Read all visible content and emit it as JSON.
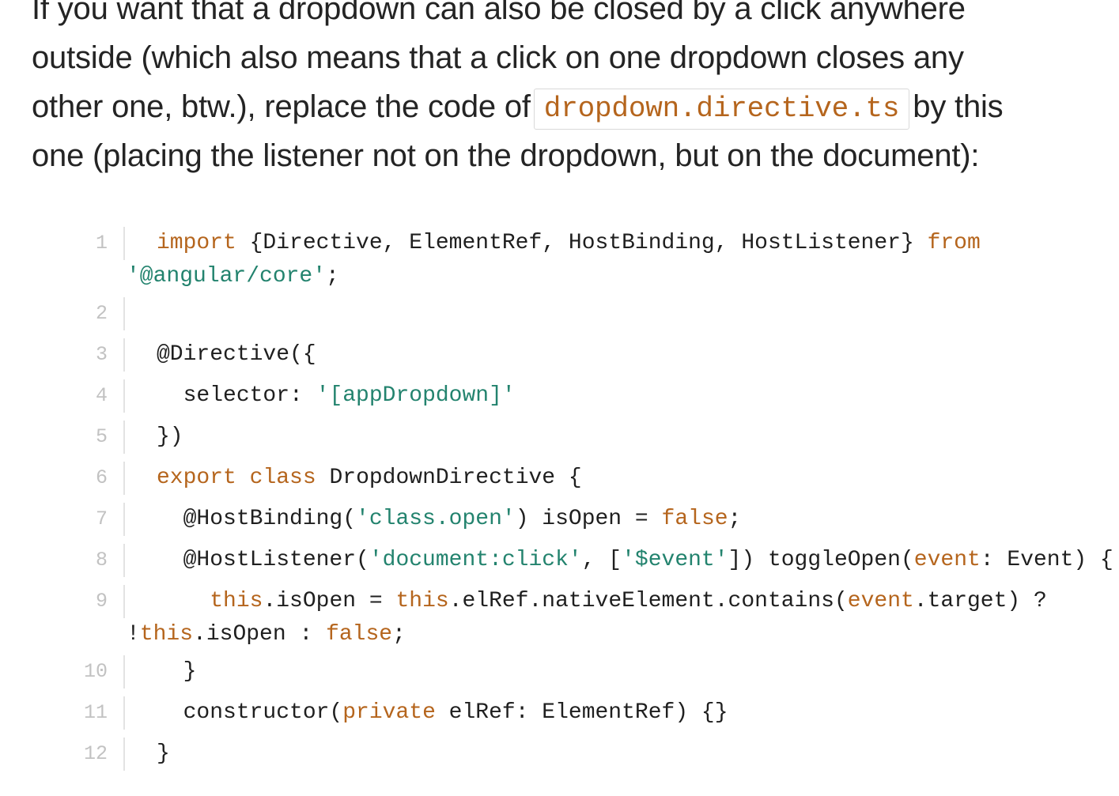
{
  "paragraph": {
    "line1": "If you want that a dropdown can also be closed by a click anywhere",
    "line2": "outside (which also means that a click on one dropdown closes any",
    "line3_before": "other one, btw.), replace the code of",
    "inline_code": "dropdown.directive.ts",
    "line3_after": "by this",
    "line4": "one (placing the listener not on the dropdown, but on the document):"
  },
  "code": {
    "line_numbers": [
      "1",
      "2",
      "3",
      "4",
      "5",
      "6",
      "7",
      "8",
      "9",
      "10",
      "11",
      "12"
    ],
    "l1": {
      "kw_import": "import",
      "mid": " {Directive, ElementRef, HostBinding, HostListener} ",
      "kw_from": "from",
      "str": "'@angular/core'",
      "end": ";"
    },
    "l3": {
      "text": "@Directive({"
    },
    "l4": {
      "pre": "  selector: ",
      "str": "'[appDropdown]'"
    },
    "l5": {
      "text": "})"
    },
    "l6": {
      "kw_export": "export",
      "sp": " ",
      "kw_class": "class",
      "rest": " DropdownDirective {"
    },
    "l7": {
      "pre": "  @HostBinding(",
      "str": "'class.open'",
      "mid": ") isOpen = ",
      "kw_false": "false",
      "end": ";"
    },
    "l8": {
      "pre": "  @HostListener(",
      "str1": "'document:click'",
      "mid1": ", [",
      "str2": "'$event'",
      "mid2": "]) toggleOpen(",
      "kw_event": "event",
      "end": ": Event) {"
    },
    "l9": {
      "pre": "    ",
      "kw_this1": "this",
      "mid1": ".isOpen = ",
      "kw_this2": "this",
      "mid2": ".elRef.nativeElement.contains(",
      "kw_event": "event",
      "mid3": ".target) ?",
      "cont_pre": "!",
      "kw_this3": "this",
      "cont_mid": ".isOpen : ",
      "kw_false": "false",
      "cont_end": ";"
    },
    "l10": {
      "text": "  }"
    },
    "l11": {
      "pre": "  constructor(",
      "kw_private": "private",
      "rest": " elRef: ElementRef) {}"
    },
    "l12": {
      "text": "}"
    }
  },
  "colors": {
    "keyword": "#b5651d",
    "string": "#23836e",
    "text": "#1f1f1f",
    "line_number": "#c2c2c2"
  }
}
